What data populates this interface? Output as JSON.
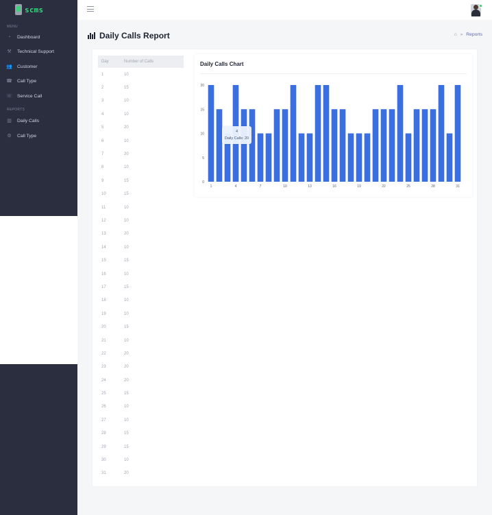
{
  "app": {
    "logo_text": "scms"
  },
  "sidebar": {
    "section_menu": "MENU",
    "menu_items": [
      {
        "label": "Dashboard",
        "icon": "dashboard-icon"
      },
      {
        "label": "Technical Support",
        "icon": "wrench-icon"
      },
      {
        "label": "Customer",
        "icon": "users-icon"
      },
      {
        "label": "Call Type",
        "icon": "phone-icon"
      },
      {
        "label": "Service Call",
        "icon": "phone-icon"
      }
    ],
    "section_reports": "REPORTS",
    "report_items": [
      {
        "label": "Daily Calls",
        "icon": "bar-chart-icon"
      },
      {
        "label": "Call Type",
        "icon": "settings-icon"
      }
    ]
  },
  "header": {
    "title": "Daily Calls Report",
    "breadcrumb_label": "Reports"
  },
  "table": {
    "headers": [
      "Day",
      "Number of Calls"
    ],
    "rows": [
      [
        "1",
        "10"
      ],
      [
        "2",
        "15"
      ],
      [
        "3",
        "10"
      ],
      [
        "4",
        "10"
      ],
      [
        "5",
        "20"
      ],
      [
        "6",
        "10"
      ],
      [
        "7",
        "20"
      ],
      [
        "8",
        "10"
      ],
      [
        "9",
        "15"
      ],
      [
        "10",
        "15"
      ],
      [
        "11",
        "10"
      ],
      [
        "12",
        "10"
      ],
      [
        "13",
        "20"
      ],
      [
        "14",
        "10"
      ],
      [
        "15",
        "15"
      ],
      [
        "16",
        "10"
      ],
      [
        "17",
        "15"
      ],
      [
        "18",
        "10"
      ],
      [
        "19",
        "10"
      ],
      [
        "20",
        "15"
      ],
      [
        "21",
        "10"
      ],
      [
        "22",
        "20"
      ],
      [
        "23",
        "20"
      ],
      [
        "24",
        "20"
      ],
      [
        "25",
        "15"
      ],
      [
        "26",
        "10"
      ],
      [
        "27",
        "10"
      ],
      [
        "28",
        "15"
      ],
      [
        "29",
        "15"
      ],
      [
        "30",
        "10"
      ],
      [
        "31",
        "20"
      ]
    ]
  },
  "chart_data": {
    "type": "bar",
    "title": "Daily Calls Chart",
    "categories": [
      "1",
      "2",
      "3",
      "4",
      "5",
      "6",
      "7",
      "8",
      "9",
      "10",
      "11",
      "12",
      "13",
      "14",
      "15",
      "16",
      "17",
      "18",
      "19",
      "20",
      "21",
      "22",
      "23",
      "24",
      "25",
      "26",
      "27",
      "28",
      "29",
      "30",
      "31"
    ],
    "x_tick_labels": [
      "1",
      "4",
      "7",
      "10",
      "13",
      "16",
      "19",
      "22",
      "25",
      "28",
      "31"
    ],
    "y_ticks": [
      0,
      5,
      10,
      15,
      20
    ],
    "ylim": [
      0,
      20
    ],
    "series": [
      {
        "name": "Daily Calls",
        "values": [
          20,
          15,
          10,
          20,
          15,
          15,
          10,
          10,
          15,
          15,
          20,
          10,
          10,
          20,
          20,
          15,
          15,
          10,
          10,
          10,
          15,
          15,
          15,
          20,
          10,
          15,
          15,
          15,
          20,
          10,
          20
        ]
      }
    ],
    "bar_color": "#3b6fe0",
    "grid": false,
    "tooltip": {
      "title": "4",
      "label": "Daily Calls",
      "value": "20"
    }
  }
}
